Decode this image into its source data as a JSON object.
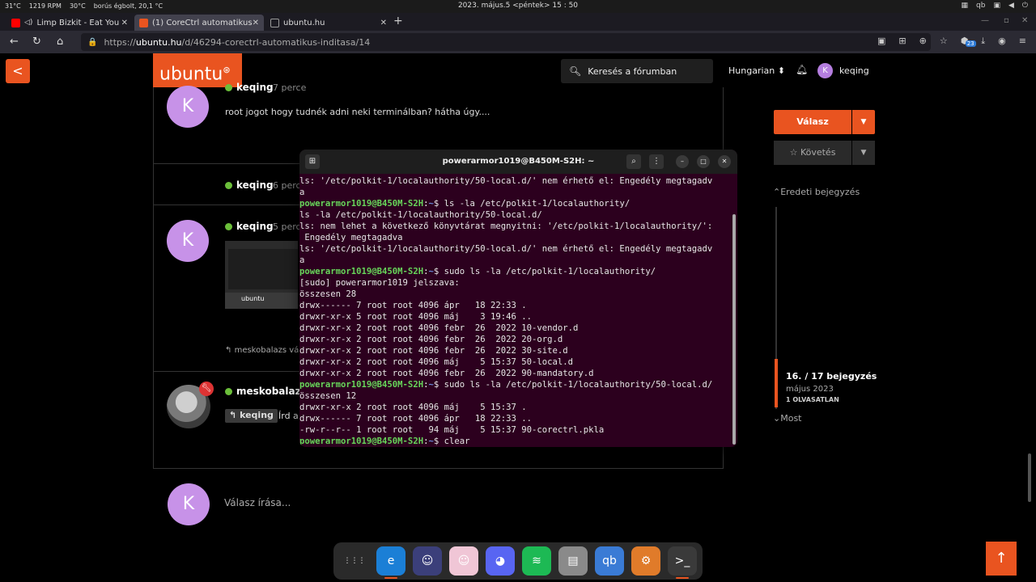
{
  "system_bar": {
    "indicators": [
      "31°C",
      "1219 RPM",
      "30°C",
      "borús égbolt, 20,1 °C"
    ],
    "clock": "2023. május.5 <péntek> 15 : 50"
  },
  "browser": {
    "tabs": [
      {
        "label": "Limp Bizkit - Eat You",
        "favicon_color": "#ff0000",
        "active": false
      },
      {
        "label": "(1) CoreCtrl automatikus",
        "favicon_color": "#e95420",
        "active": true
      },
      {
        "label": "ubuntu.hu",
        "favicon_color": "#999999",
        "active": false
      }
    ],
    "new_tab_glyph": "+",
    "url": {
      "scheme": "https://",
      "host": "ubuntu.hu",
      "path": "/d/46294-corectrl-automatikus-inditasa/14"
    },
    "extension_badge": "23"
  },
  "site": {
    "brand": "ubuntu",
    "search_label": "Keresés a fórumban",
    "language": "Hungarian",
    "user_initial": "K",
    "user_name": "keqing",
    "back_glyph": "<"
  },
  "posts": [
    {
      "author": "keqing",
      "ago": "7 perce",
      "initial": "K",
      "text": "root jogot hogy tudnék adni neki terminálban? hátha úgy...."
    },
    {
      "author": "keqing",
      "ago": "6 perce"
    },
    {
      "author": "keqing",
      "ago": "5 perce",
      "initial": "K",
      "thumbnail_brand": "ubuntu",
      "reply_credit": "meskobalazs válasz"
    },
    {
      "author": "meskobalazs",
      "quote_user": "keqing",
      "quote_text": "Írd a"
    }
  ],
  "compose": {
    "initial": "K",
    "placeholder": "Válasz írása..."
  },
  "sidebar": {
    "reply_button": "Válasz",
    "follow_button": "Követés",
    "original_post": "Eredeti bejegyzés",
    "position": "16. / 17 bejegyzés",
    "date": "május 2023",
    "unread": "1 OLVASATLAN",
    "now": "Most"
  },
  "terminal": {
    "title": "powerarmor1019@B450M-S2H: ~",
    "prompt_user": "powerarmor1019@B450M-S2H",
    "prompt_path": "~",
    "lines": [
      {
        "type": "out",
        "text": "ls: '/etc/polkit-1/localauthority/50-local.d/' nem érhető el: Engedély megtagadv"
      },
      {
        "type": "out",
        "text": "a"
      },
      {
        "type": "cmd",
        "text": "ls -la /etc/polkit-1/localauthority/"
      },
      {
        "type": "out",
        "text": "ls -la /etc/polkit-1/localauthority/50-local.d/"
      },
      {
        "type": "out",
        "text": "ls: nem lehet a következő könyvtárat megnyitni: '/etc/polkit-1/localauthority/':"
      },
      {
        "type": "out",
        "text": " Engedély megtagadva"
      },
      {
        "type": "out",
        "text": "ls: '/etc/polkit-1/localauthority/50-local.d/' nem érhető el: Engedély megtagadv"
      },
      {
        "type": "out",
        "text": "a"
      },
      {
        "type": "cmd",
        "text": "sudo ls -la /etc/polkit-1/localauthority/"
      },
      {
        "type": "out",
        "text": "[sudo] powerarmor1019 jelszava:"
      },
      {
        "type": "out",
        "text": "összesen 28"
      },
      {
        "type": "out",
        "text": "drwx------ 7 root root 4096 ápr   18 22:33 ."
      },
      {
        "type": "out",
        "text": "drwxr-xr-x 5 root root 4096 máj    3 19:46 .."
      },
      {
        "type": "out",
        "text": "drwxr-xr-x 2 root root 4096 febr  26  2022 10-vendor.d"
      },
      {
        "type": "out",
        "text": "drwxr-xr-x 2 root root 4096 febr  26  2022 20-org.d"
      },
      {
        "type": "out",
        "text": "drwxr-xr-x 2 root root 4096 febr  26  2022 30-site.d"
      },
      {
        "type": "out",
        "text": "drwxr-xr-x 2 root root 4096 máj    5 15:37 50-local.d"
      },
      {
        "type": "out",
        "text": "drwxr-xr-x 2 root root 4096 febr  26  2022 90-mandatory.d"
      },
      {
        "type": "cmd",
        "text": "sudo ls -la /etc/polkit-1/localauthority/50-local.d/"
      },
      {
        "type": "out",
        "text": "összesen 12"
      },
      {
        "type": "out",
        "text": "drwxr-xr-x 2 root root 4096 máj    5 15:37 ."
      },
      {
        "type": "out",
        "text": "drwx------ 7 root root 4096 ápr   18 22:33 .."
      },
      {
        "type": "out",
        "text": "-rw-r--r-- 1 root root   94 máj    5 15:37 90-corectrl.pkla"
      },
      {
        "type": "cmd",
        "text": "clear"
      }
    ]
  },
  "dock": [
    {
      "name": "app-grid-icon",
      "glyph": "⋮⋮⋮",
      "bg": "#2a2a2a",
      "running": false
    },
    {
      "name": "edge-icon",
      "glyph": "e",
      "bg": "#1b7fd6",
      "running": true
    },
    {
      "name": "anime-character-icon",
      "glyph": "☺",
      "bg": "#3b3f7a",
      "running": false
    },
    {
      "name": "anime-character-pink-icon",
      "glyph": "☺",
      "bg": "#f0c6d6",
      "running": false
    },
    {
      "name": "discord-icon",
      "glyph": "◕",
      "bg": "#5865f2",
      "running": false
    },
    {
      "name": "spotify-icon",
      "glyph": "≋",
      "bg": "#1db954",
      "running": false
    },
    {
      "name": "files-icon",
      "glyph": "▤",
      "bg": "#8a8a8a",
      "running": false
    },
    {
      "name": "qbittorrent-icon",
      "glyph": "qb",
      "bg": "#3a7bd5",
      "running": false
    },
    {
      "name": "corectrl-icon",
      "glyph": "⚙",
      "bg": "#e07b2a",
      "running": false
    },
    {
      "name": "terminal-icon",
      "glyph": ">_",
      "bg": "#3a3a3a",
      "running": true
    }
  ],
  "colors": {
    "accent": "#e95420",
    "online": "#6bbf3a",
    "terminal_bg": "#2c001e"
  }
}
